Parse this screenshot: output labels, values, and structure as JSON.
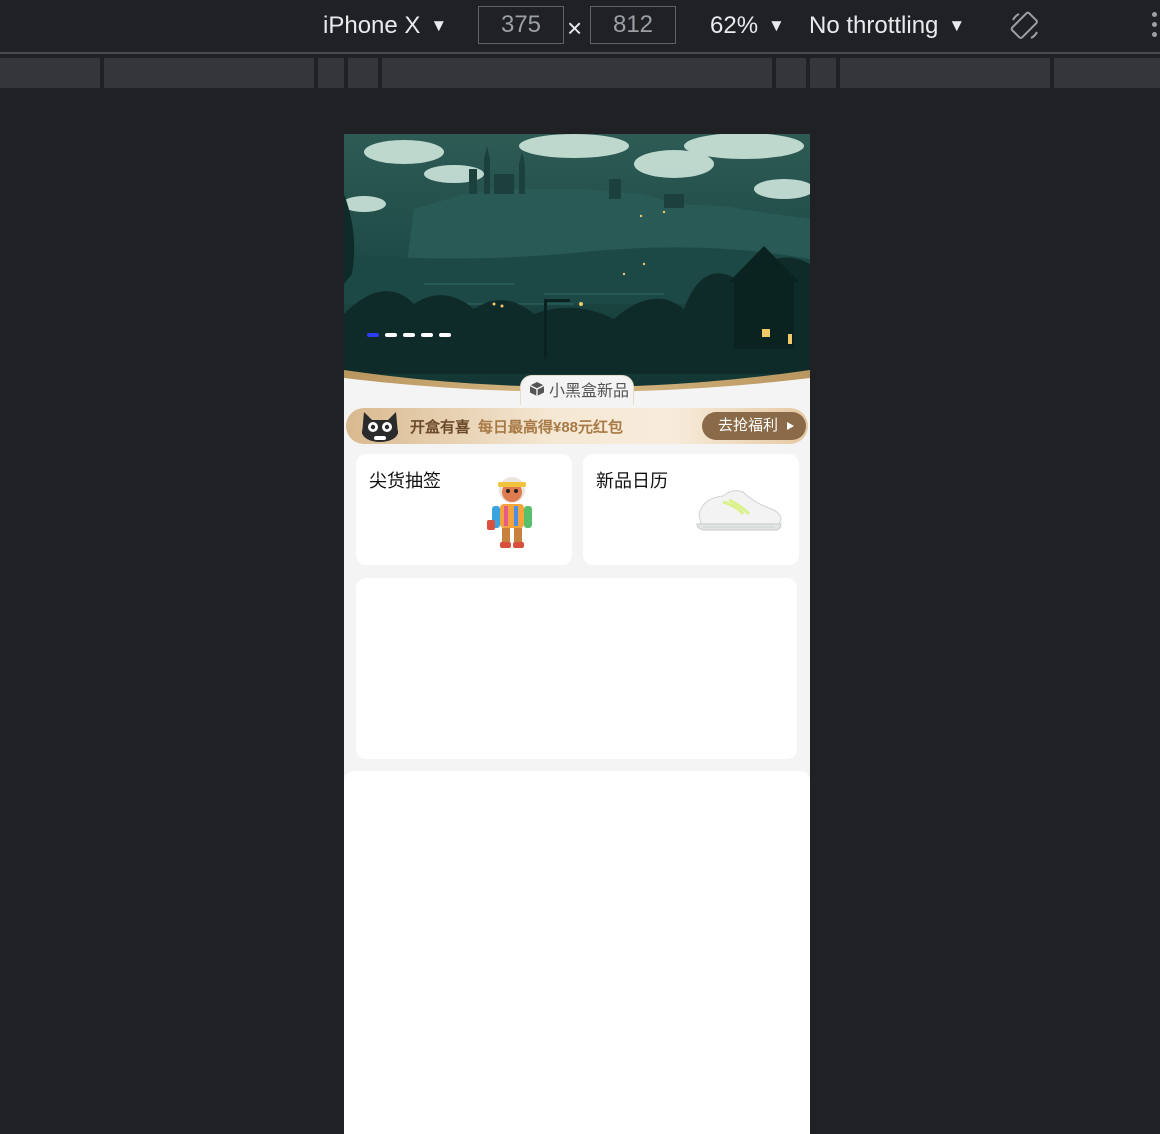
{
  "devtools": {
    "device": "iPhone X",
    "width": "375",
    "times": "×",
    "height": "812",
    "zoom": "62%",
    "throttling": "No throttling",
    "arrow": "▼"
  },
  "banner": {
    "carousel_total": 5,
    "carousel_active": 1
  },
  "section_tag": "小黑盒新品",
  "promo": {
    "title": "开盒有喜",
    "subtitle": "每日最高得¥88元红包",
    "button": "去抢福利"
  },
  "cards": [
    {
      "title": "尖货抽签"
    },
    {
      "title": "新品日历"
    }
  ],
  "colors": {
    "carousel_active": "#2d3df0",
    "promo_button": "#8a6a48",
    "page_background": "#f4f4f4"
  }
}
